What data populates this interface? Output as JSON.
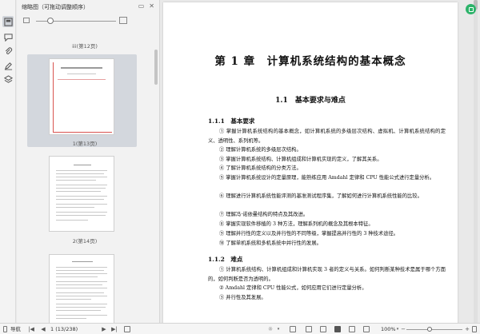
{
  "sidebar": {
    "title": "缩略图（可拖动调整顺序）",
    "rail_icons": [
      "thumbnail-icon",
      "comment-icon",
      "attachment-icon",
      "signature-icon",
      "stamp-icon",
      "layers-icon"
    ]
  },
  "thumbnails": [
    {
      "label": "iii(第12页)"
    },
    {
      "label": "1(第13页)",
      "selected": true
    },
    {
      "label": "2(第14页)"
    }
  ],
  "document": {
    "chapter_title": "第 1 章　计算机系统结构的基本概念",
    "section_title": "1.1　基本要求与难点",
    "sub1_title": "1.1.1　基本要求",
    "items1": [
      "① 掌握计算机系统结构的基本概念，如计算机系统的多级层次结构、虚拟机、计算机系统结构的定义、透明性、系列机等。",
      "② 理解计算机系统的多级层次结构。",
      "③ 掌握计算机系统结构、计算机组成和计算机实现的定义，了解其关系。",
      "④ 了解计算机系统结构的分类方法。",
      "⑤ 掌握计算机系统设计的定量原理，能熟练应用 Amdahl 定律和 CPU 性能公式进行定量分析。",
      "⑥ 理解进行计算机系统性能评测的基准测试程序集，了解如何进行计算机系统性能的比较。",
      "⑦ 理解冯·诺依曼结构的特点及其改进。",
      "⑧ 掌握实现软件移植的 3 种方法，理解系列机的概念及其根本特征。",
      "⑨ 理解并行性的定义以及并行性的不同等级，掌握提高并行性的 3 种技术途径。",
      "⑩ 了解单机系统和多机系统中并行性的发展。"
    ],
    "sub2_title": "1.1.2　难点",
    "items2": [
      "① 计算机系统结构、计算机组成和计算机实现 3 者的定义与关系。如何判断某种技术是属于哪个方面的，如何判断是否为透明的。",
      "② Amdahl 定律和 CPU 性能公式，如何应用它们进行定量分析。",
      "③ 并行性及其发展。"
    ]
  },
  "status": {
    "nav_label": "导航",
    "page_indicator": "1 (13/238)",
    "zoom": "100%"
  },
  "colors": {
    "accent": "#2db36a",
    "selection": "#d3d7dd",
    "thumb_red": "#d9534f"
  }
}
